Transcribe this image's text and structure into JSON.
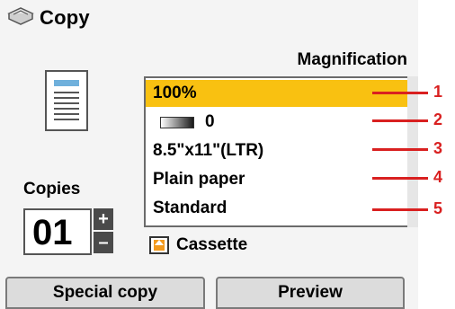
{
  "header": {
    "title": "Copy",
    "icon": "copy-icon"
  },
  "magnification_label": "Magnification",
  "settings": [
    {
      "value": "100%",
      "selected": true
    },
    {
      "value": "0",
      "icon": "density-gradient-icon"
    },
    {
      "value": "8.5\"x11\"(LTR)"
    },
    {
      "value": "Plain paper"
    },
    {
      "value": "Standard"
    }
  ],
  "callouts": [
    "1",
    "2",
    "3",
    "4",
    "5"
  ],
  "copies": {
    "label": "Copies",
    "value": "01",
    "plus": "+",
    "minus": "–"
  },
  "paper_source": {
    "label": "Cassette",
    "icon": "cassette-icon"
  },
  "buttons": {
    "special": "Special copy",
    "preview": "Preview"
  },
  "colors": {
    "selected_row": "#f9c111",
    "callout": "#d92020",
    "doc_band": "#6fb0dc"
  }
}
